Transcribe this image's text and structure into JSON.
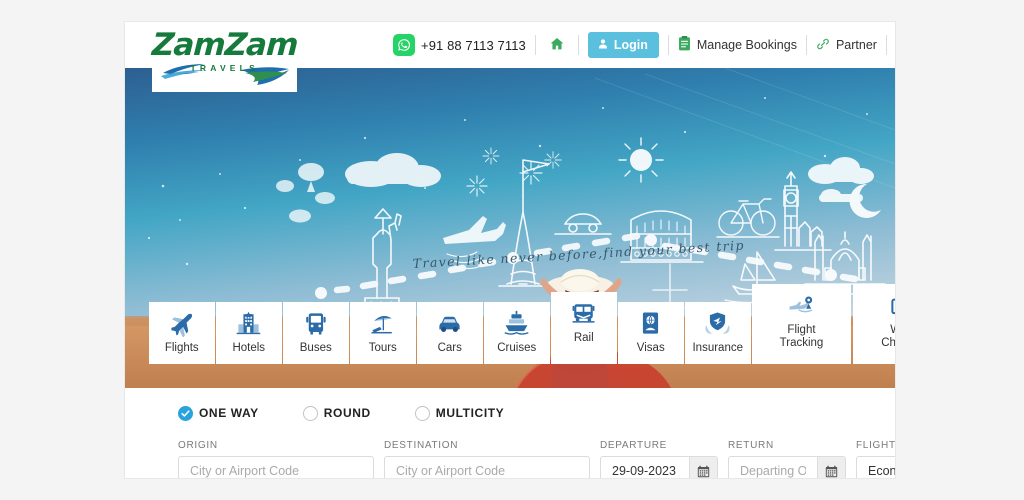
{
  "brand": {
    "name": "ZamZam",
    "tagline": "TRAVELS",
    "green": "#167a3c",
    "blue": "#2a7fc1"
  },
  "header": {
    "whatsapp_icon": "whatsapp-icon",
    "phone": "+91 88 7113 7113",
    "home_icon": "home-icon",
    "login_label": "Login",
    "login_icon": "user-icon",
    "manage_bookings_label": "Manage Bookings",
    "manage_bookings_icon": "clipboard-icon",
    "partner_label": "Partner",
    "partner_icon": "link-icon",
    "flag_icon": "india-flag-icon",
    "accent_blue": "#5bc0de",
    "accent_green": "#25d366"
  },
  "hero": {
    "headline": "Travel like never before,find your best trip",
    "sky_top": "#2b6ea8",
    "sky_mid": "#3fa5c4",
    "sky_bottom": "#b9cfe0",
    "sand": "#c98a5a"
  },
  "tabs": [
    {
      "label": "Flights",
      "icon": "airplane-icon",
      "active": false,
      "two_line": false
    },
    {
      "label": "Hotels",
      "icon": "hotel-icon",
      "active": false,
      "two_line": false
    },
    {
      "label": "Buses",
      "icon": "bus-icon",
      "active": false,
      "two_line": false
    },
    {
      "label": "Tours",
      "icon": "beach-icon",
      "active": false,
      "two_line": false
    },
    {
      "label": "Cars",
      "icon": "car-icon",
      "active": false,
      "two_line": false
    },
    {
      "label": "Cruises",
      "icon": "ship-icon",
      "active": false,
      "two_line": false
    },
    {
      "label": "Rail",
      "icon": "train-icon",
      "active": true,
      "two_line": false
    },
    {
      "label": "Visas",
      "icon": "passport-icon",
      "active": false,
      "two_line": false
    },
    {
      "label": "Insurance",
      "icon": "shield-icon",
      "active": false,
      "two_line": false
    },
    {
      "label": "Flight\nTracking",
      "icon": "radar-icon",
      "active": false,
      "two_line": true
    },
    {
      "label": "Web\nCheckin",
      "icon": "web-checkin-icon",
      "active": false,
      "two_line": true
    }
  ],
  "search": {
    "trip_types": [
      {
        "label": "ONE WAY",
        "selected": true
      },
      {
        "label": "ROUND",
        "selected": false
      },
      {
        "label": "MULTICITY",
        "selected": false
      }
    ],
    "fields": {
      "origin": {
        "label": "ORIGIN",
        "value": "",
        "placeholder": "City or Airport Code"
      },
      "destination": {
        "label": "DESTINATION",
        "value": "",
        "placeholder": "City or Airport Code"
      },
      "departure": {
        "label": "DEPARTURE",
        "value": "29-09-2023",
        "placeholder": ""
      },
      "return": {
        "label": "RETURN",
        "value": "",
        "placeholder": "Departing On"
      },
      "flight_class": {
        "label": "FLIGHT",
        "value": "Economy",
        "placeholder": ""
      }
    },
    "calendar_icon": "calendar-icon"
  }
}
